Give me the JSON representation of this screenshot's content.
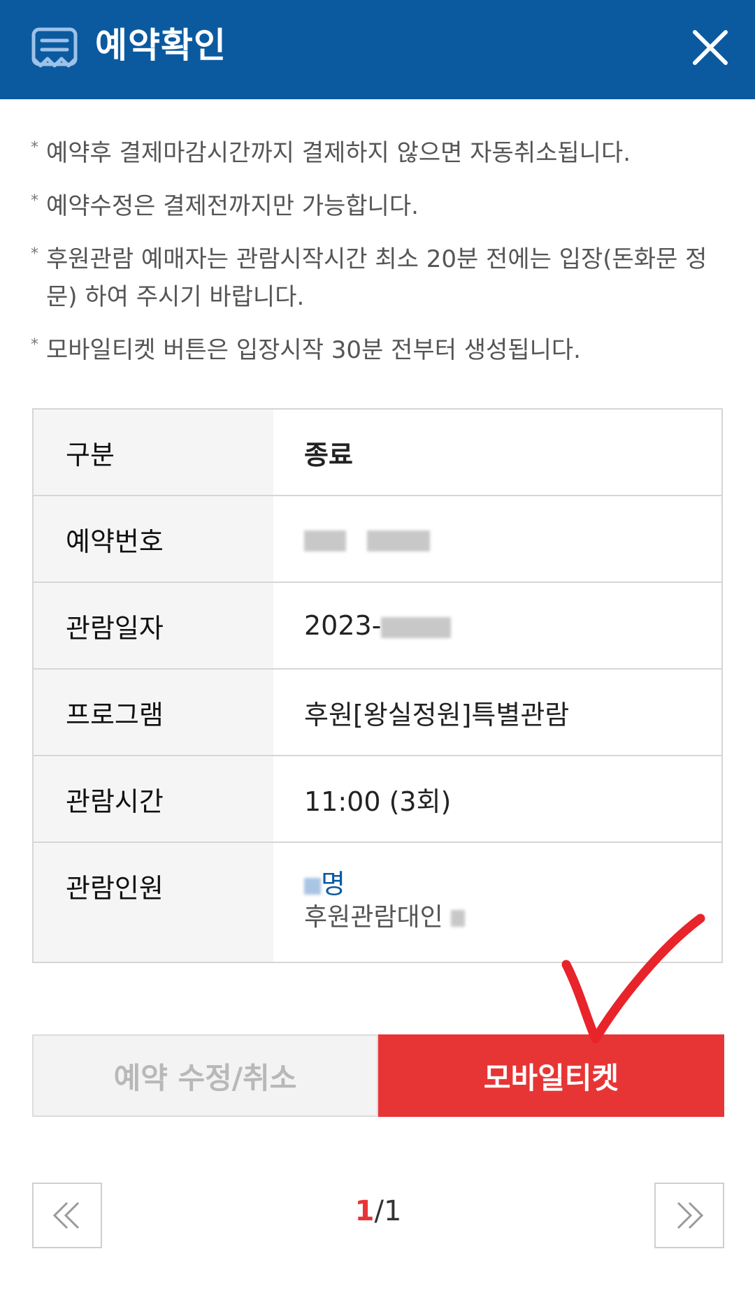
{
  "header": {
    "title": "예약확인",
    "icon": "receipt-icon",
    "close_icon": "close-icon"
  },
  "notices": [
    "예약후 결제마감시간까지 결제하지 않으면 자동취소됩니다.",
    "예약수정은 결제전까지만 가능합니다.",
    "후원관람 예매자는 관람시작시간 최소 20분 전에는 입장(돈화문 정문) 하여 주시기 바랍니다.",
    "모바일티켓 버튼은 입장시작 30분 전부터 생성됩니다."
  ],
  "info": {
    "status_label": "구분",
    "status_value": "종료",
    "reservation_label": "예약번호",
    "date_label": "관람일자",
    "date_value": "2023-",
    "program_label": "프로그램",
    "program_value": "후원[왕실정원]특별관람",
    "time_label": "관람시간",
    "time_value": "11:00 (3회)",
    "people_label": "관람인원",
    "people_count": "명",
    "people_detail": "후원관람대인"
  },
  "buttons": {
    "edit_cancel": "예약 수정/취소",
    "mobile_ticket": "모바일티켓"
  },
  "pager": {
    "current": "1",
    "separator": "/",
    "total": "1"
  },
  "colors": {
    "header": "#0b5aa0",
    "ticket_button": "#e73535",
    "check_mark": "#e8232a"
  }
}
